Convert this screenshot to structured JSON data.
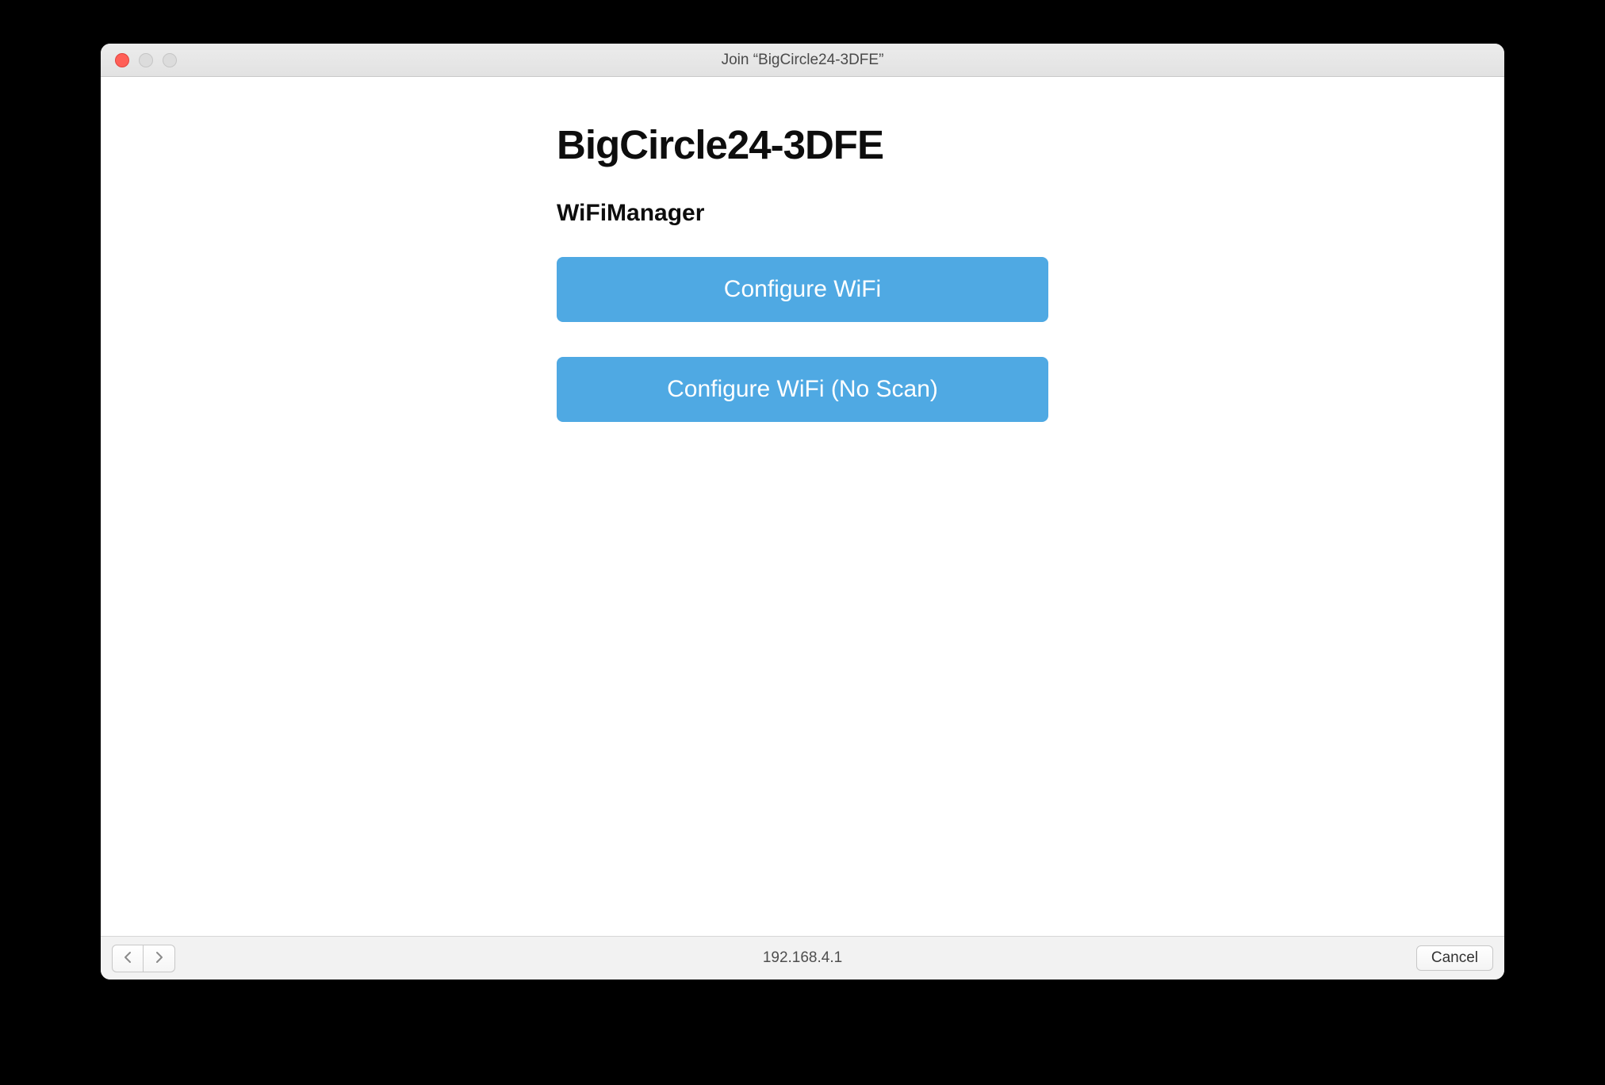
{
  "window": {
    "title": "Join “BigCircle24-3DFE”"
  },
  "page": {
    "heading": "BigCircle24-3DFE",
    "subheading": "WiFiManager",
    "buttons": {
      "configure": "Configure WiFi",
      "configure_noscan": "Configure WiFi (No Scan)"
    }
  },
  "toolbar": {
    "address": "192.168.4.1",
    "cancel": "Cancel"
  }
}
